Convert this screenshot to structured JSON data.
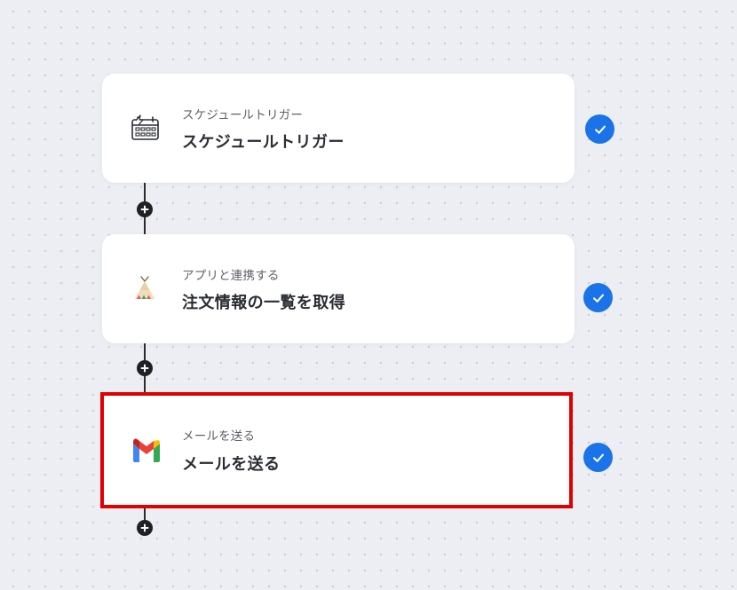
{
  "flow": {
    "steps": [
      {
        "category": "スケジュールトリガー",
        "title": "スケジュールトリガー",
        "icon": "schedule-calendar-icon",
        "status": "completed"
      },
      {
        "category": "アプリと連携する",
        "title": "注文情報の一覧を取得",
        "icon": "tent-app-icon",
        "status": "completed"
      },
      {
        "category": "メールを送る",
        "title": "メールを送る",
        "icon": "gmail-icon",
        "status": "completed",
        "selected": true
      }
    ],
    "add_step_icon": "plus-icon",
    "status_icon": "check-icon"
  },
  "colors": {
    "canvas_background": "#eceef3",
    "check_badge": "#1a73e8",
    "selection_outline": "#e00000",
    "connector": "#2b2b2b"
  }
}
